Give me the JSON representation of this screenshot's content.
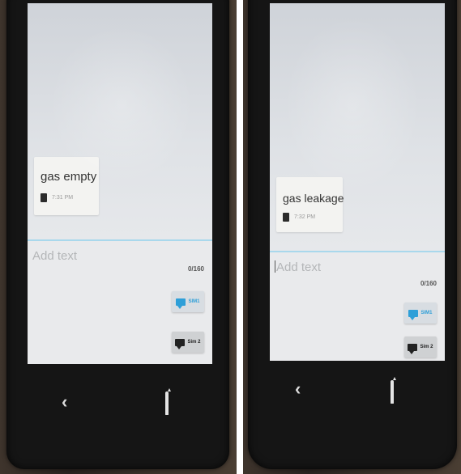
{
  "panels": [
    {
      "message": {
        "text": "gas empty",
        "time": "7:31 PM"
      },
      "compose": {
        "placeholder": "Add text",
        "counter": "0/160"
      },
      "buttons": {
        "sim1_label": "SIM1",
        "sim2_label": "Sim 2"
      }
    },
    {
      "message": {
        "text": "gas leakage",
        "time": "7:32 PM"
      },
      "compose": {
        "placeholder": "Add text",
        "counter": "0/160"
      },
      "buttons": {
        "sim1_label": "SIM1",
        "sim2_label": "Sim 2"
      }
    }
  ],
  "icons": {
    "contact": "contact-avatar-icon",
    "send_sim1": "message-bubble-icon",
    "send_sim2": "message-bubble-icon",
    "back": "back-chevron-icon",
    "home": "home-icon"
  },
  "colors": {
    "accent": "#2e9fd8",
    "divider": "#a9d8ec",
    "screen_bg": "#dfe2e6",
    "phone_body": "#151515"
  }
}
